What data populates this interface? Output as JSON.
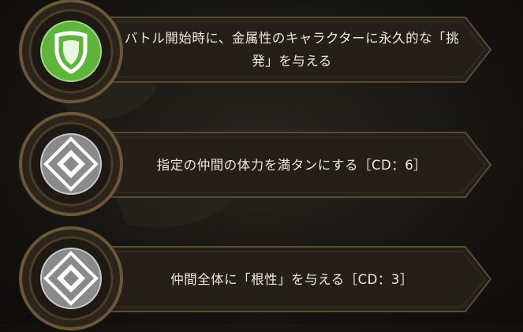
{
  "skills": [
    {
      "icon": "shield-icon",
      "description": "バトル開始時に、金属性のキャラクターに永久的な「挑発」を与える",
      "accent": "#5fb53a"
    },
    {
      "icon": "diamond-crest-icon",
      "description": "指定の仲間の体力を満タンにする［CD：6］",
      "accent": "#8a8a8a"
    },
    {
      "icon": "diamond-crest-icon",
      "description": "仲間全体に「根性」を与える［CD：3］",
      "accent": "#8a8a8a"
    }
  ]
}
